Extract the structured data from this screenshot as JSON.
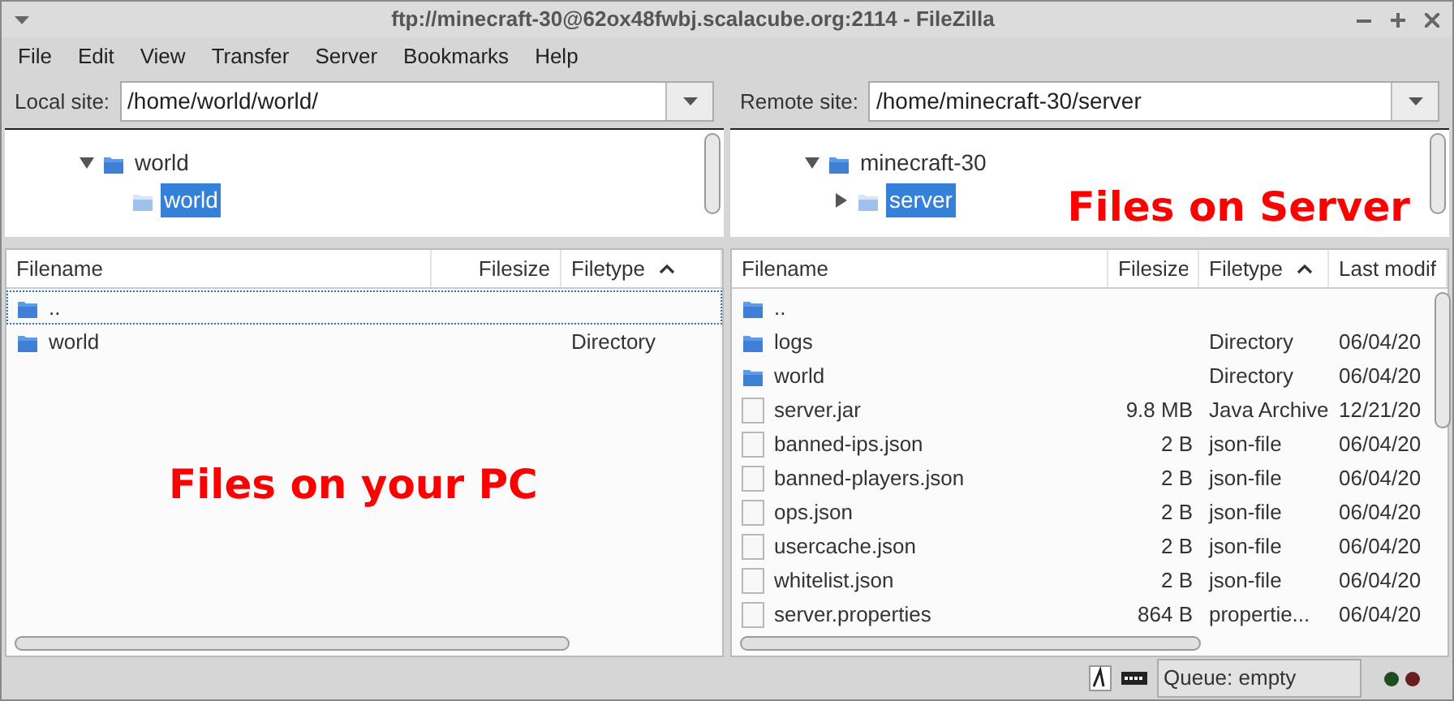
{
  "window": {
    "title": "ftp://minecraft-30@62ox48fwbj.scalacube.org:2114 - FileZilla"
  },
  "menu": [
    "File",
    "Edit",
    "View",
    "Transfer",
    "Server",
    "Bookmarks",
    "Help"
  ],
  "panes": [
    {
      "site_label": "Local site:",
      "path": "/home/world/world/",
      "tree": [
        {
          "label": "world",
          "expanded": true,
          "selected": false,
          "children": [
            {
              "label": "world",
              "selected": true
            }
          ]
        }
      ],
      "columns": [
        {
          "label": "Filename",
          "sorted": false
        },
        {
          "label": "Filesize",
          "sorted": false
        },
        {
          "label": "Filetype",
          "sorted": true
        }
      ],
      "rows": [
        {
          "kind": "folder",
          "focused": true,
          "cells": [
            "..",
            "",
            ""
          ]
        },
        {
          "kind": "folder",
          "focused": false,
          "cells": [
            "world",
            "",
            "Directory"
          ]
        }
      ],
      "annotation": "Files on your PC"
    },
    {
      "site_label": "Remote site:",
      "path": "/home/minecraft-30/server",
      "tree": [
        {
          "label": "minecraft-30",
          "expanded": true,
          "selected": false,
          "children": [
            {
              "label": "server",
              "expanded": false,
              "selected": true
            }
          ]
        }
      ],
      "columns": [
        {
          "label": "Filename",
          "sorted": false
        },
        {
          "label": "Filesize",
          "sorted": false
        },
        {
          "label": "Filetype",
          "sorted": true
        },
        {
          "label": "Last modif",
          "sorted": false
        }
      ],
      "rows": [
        {
          "kind": "folder",
          "focused": false,
          "cells": [
            "..",
            "",
            "",
            ""
          ]
        },
        {
          "kind": "folder",
          "focused": false,
          "cells": [
            "logs",
            "",
            "Directory",
            "06/04/20"
          ]
        },
        {
          "kind": "folder",
          "focused": false,
          "cells": [
            "world",
            "",
            "Directory",
            "06/04/20"
          ]
        },
        {
          "kind": "file",
          "focused": false,
          "cells": [
            "server.jar",
            "9.8 MB",
            "Java Archive",
            "12/21/20"
          ]
        },
        {
          "kind": "file",
          "focused": false,
          "cells": [
            "banned-ips.json",
            "2 B",
            "json-file",
            "06/04/20"
          ]
        },
        {
          "kind": "file",
          "focused": false,
          "cells": [
            "banned-players.json",
            "2 B",
            "json-file",
            "06/04/20"
          ]
        },
        {
          "kind": "file",
          "focused": false,
          "cells": [
            "ops.json",
            "2 B",
            "json-file",
            "06/04/20"
          ]
        },
        {
          "kind": "file",
          "focused": false,
          "cells": [
            "usercache.json",
            "2 B",
            "json-file",
            "06/04/20"
          ]
        },
        {
          "kind": "file",
          "focused": false,
          "cells": [
            "whitelist.json",
            "2 B",
            "json-file",
            "06/04/20"
          ]
        },
        {
          "kind": "file",
          "focused": false,
          "cells": [
            "server.properties",
            "864 B",
            "propertie...",
            "06/04/20"
          ]
        }
      ],
      "annotation": "Files on Server"
    }
  ],
  "status_bar": {
    "queue": "Queue: empty"
  }
}
